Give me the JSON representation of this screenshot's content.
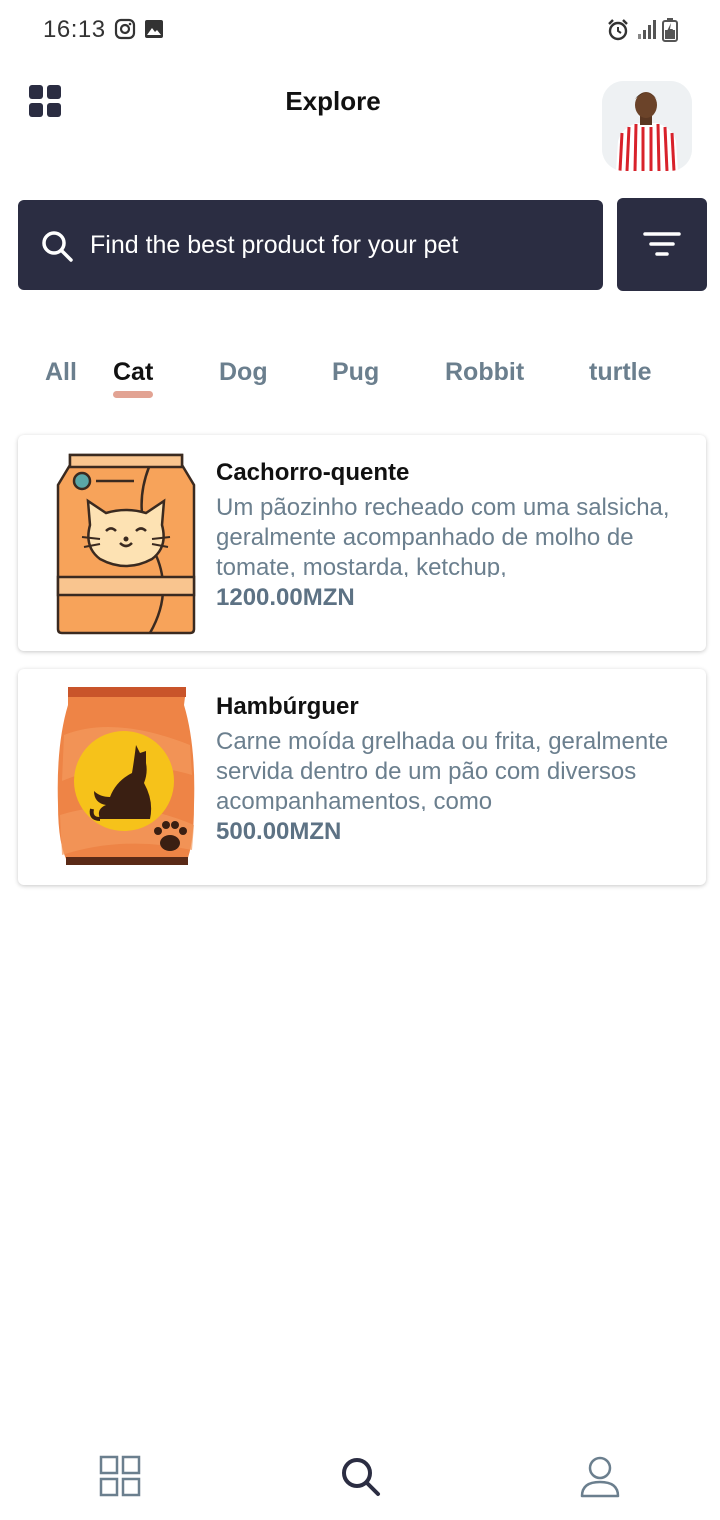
{
  "status_bar": {
    "time": "16:13",
    "icons": [
      "instagram-icon",
      "gallery-icon",
      "alarm-icon",
      "signal-icon",
      "battery-icon"
    ]
  },
  "header": {
    "title": "Explore",
    "menu_icon": "grid-icon",
    "avatar": "profile-photo"
  },
  "search": {
    "placeholder": "Find the best product for your pet",
    "icon": "search-icon",
    "filter_icon": "filter-icon"
  },
  "tabs": {
    "items": [
      "All",
      "Cat",
      "Dog",
      "Pug",
      "Robbit",
      "turtle"
    ],
    "active": "Cat"
  },
  "products": [
    {
      "name": "Cachorro-quente",
      "description": "Um pãozinho recheado com uma salsicha, geralmente acompanhado de molho de tomate, mostarda, ketchup,",
      "price": "1200.00MZN"
    },
    {
      "name": "Hambúrguer",
      "description": "Carne moída grelhada ou frita, geralmente servida dentro de um pão com diversos acompanhamentos, como",
      "price": "500.00MZN"
    }
  ],
  "bottom_nav": {
    "items": [
      "grid-icon",
      "search-icon",
      "profile-icon"
    ],
    "active": "search-icon"
  },
  "colors": {
    "dark": "#2b2d42",
    "muted": "#6b7f8e",
    "accent": "#e2a393"
  }
}
